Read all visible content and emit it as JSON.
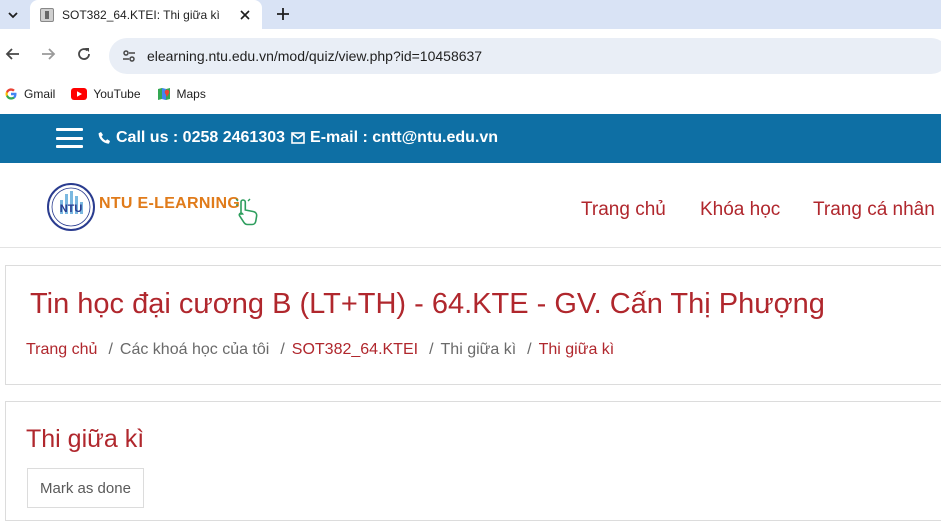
{
  "browser": {
    "tab": {
      "title": "SOT382_64.KTEI: Thi giữa kì"
    },
    "url": "elearning.ntu.edu.vn/mod/quiz/view.php?id=10458637",
    "bookmarks": [
      {
        "label": "Gmail",
        "icon": "gmail-icon"
      },
      {
        "label": "YouTube",
        "icon": "youtube-icon"
      },
      {
        "label": "Maps",
        "icon": "maps-icon"
      }
    ]
  },
  "topbar": {
    "call_label": "Call us : 0258 2461303",
    "email_label": "E-mail : cntt@ntu.edu.vn",
    "color": "#0e6fa4"
  },
  "navbar": {
    "logo_text": "NTU E-LEARNING",
    "items": [
      "Trang chủ",
      "Khóa học",
      "Trang cá nhân"
    ]
  },
  "course": {
    "title": "Tin học đại cương B (LT+TH) - 64.KTE - GV. Cấn Thị Phượng",
    "breadcrumb": [
      "Trang chủ",
      "Các khoá học của tôi",
      "SOT382_64.KTEI",
      "Thi giữa kì",
      "Thi giữa kì"
    ]
  },
  "activity": {
    "title": "Thi giữa kì",
    "mark_done_label": "Mark as done"
  },
  "colors": {
    "accent": "#b0272d",
    "header_blue": "#0e6fa4"
  }
}
